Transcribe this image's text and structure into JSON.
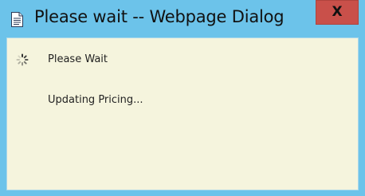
{
  "window": {
    "title": "Please wait -- Webpage Dialog",
    "close_label": "X",
    "title_icon": "document-icon",
    "colors": {
      "frame": "#6cc3ea",
      "content_bg": "#f5f4dd",
      "close_bg": "#c9504a"
    }
  },
  "body": {
    "spinner_icon": "loading-spinner-icon",
    "status_title": "Please Wait",
    "status_message": "Updating Pricing..."
  }
}
